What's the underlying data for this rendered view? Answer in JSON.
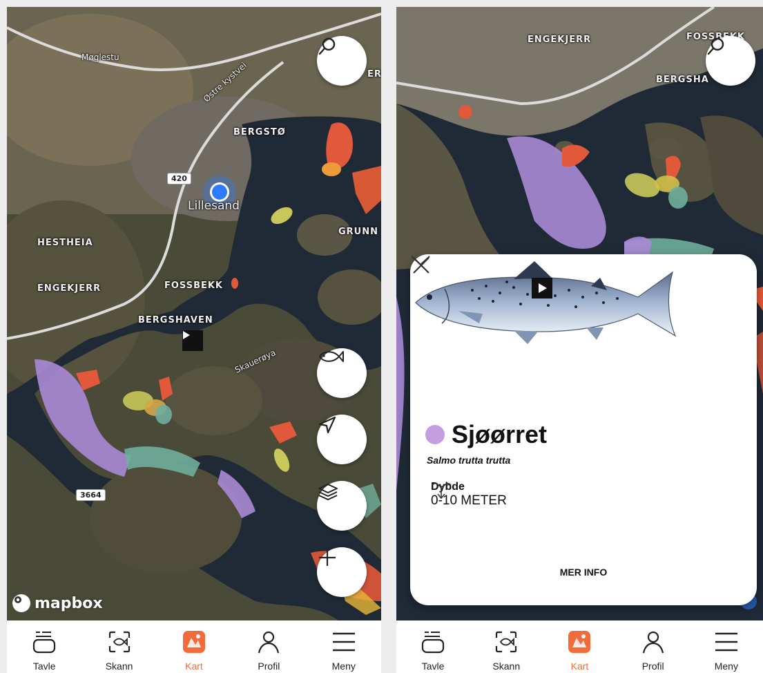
{
  "left_screen": {
    "map_labels": {
      "moglestu": "Møglestu",
      "ostre": "Østre kystvei",
      "bergsto": "BERGSTØ",
      "lillesand": "Lillesand",
      "hestheia": "HESTHEIA",
      "engekjerr": "ENGEKJERR",
      "fossbekk": "FOSSBEKK",
      "bergshaven": "BERGSHAVEN",
      "grunn": "GRUNN",
      "skauerøya": "Skauerøya",
      "edge_er": "ER"
    },
    "road_badges": {
      "r420": "420",
      "r3664": "3664"
    },
    "mapbox": "mapbox",
    "buttons": {
      "search": "search-icon",
      "fish": "fish-icon",
      "navigate": "navigation-arrow-icon",
      "layers": "layers-icon",
      "add": "plus-icon"
    }
  },
  "right_screen": {
    "map_labels": {
      "engekjerr": "ENGEKJERR",
      "fossbekk": "FOSSBEKK",
      "bergshaven": "BERGSHA"
    },
    "card": {
      "species_name": "Sjøørret",
      "latin_name": "Salmo trutta trutta",
      "depth_title": "Dybde",
      "depth_value": "0-10 METER",
      "more_info": "MER INFO",
      "dot_color": "#c49ee0"
    }
  },
  "navbar": {
    "items": [
      {
        "label": "Tavle",
        "icon": "board-icon"
      },
      {
        "label": "Skann",
        "icon": "scan-fish-icon"
      },
      {
        "label": "Kart",
        "icon": "map-icon",
        "active": true
      },
      {
        "label": "Profil",
        "icon": "profile-icon"
      },
      {
        "label": "Meny",
        "icon": "menu-icon"
      }
    ]
  },
  "colors": {
    "accent": "#f26b3a",
    "zone_purple": "#a98ad6",
    "zone_red": "#e2583a",
    "zone_yellow": "#c8c85a",
    "zone_teal": "#6fae9c"
  }
}
